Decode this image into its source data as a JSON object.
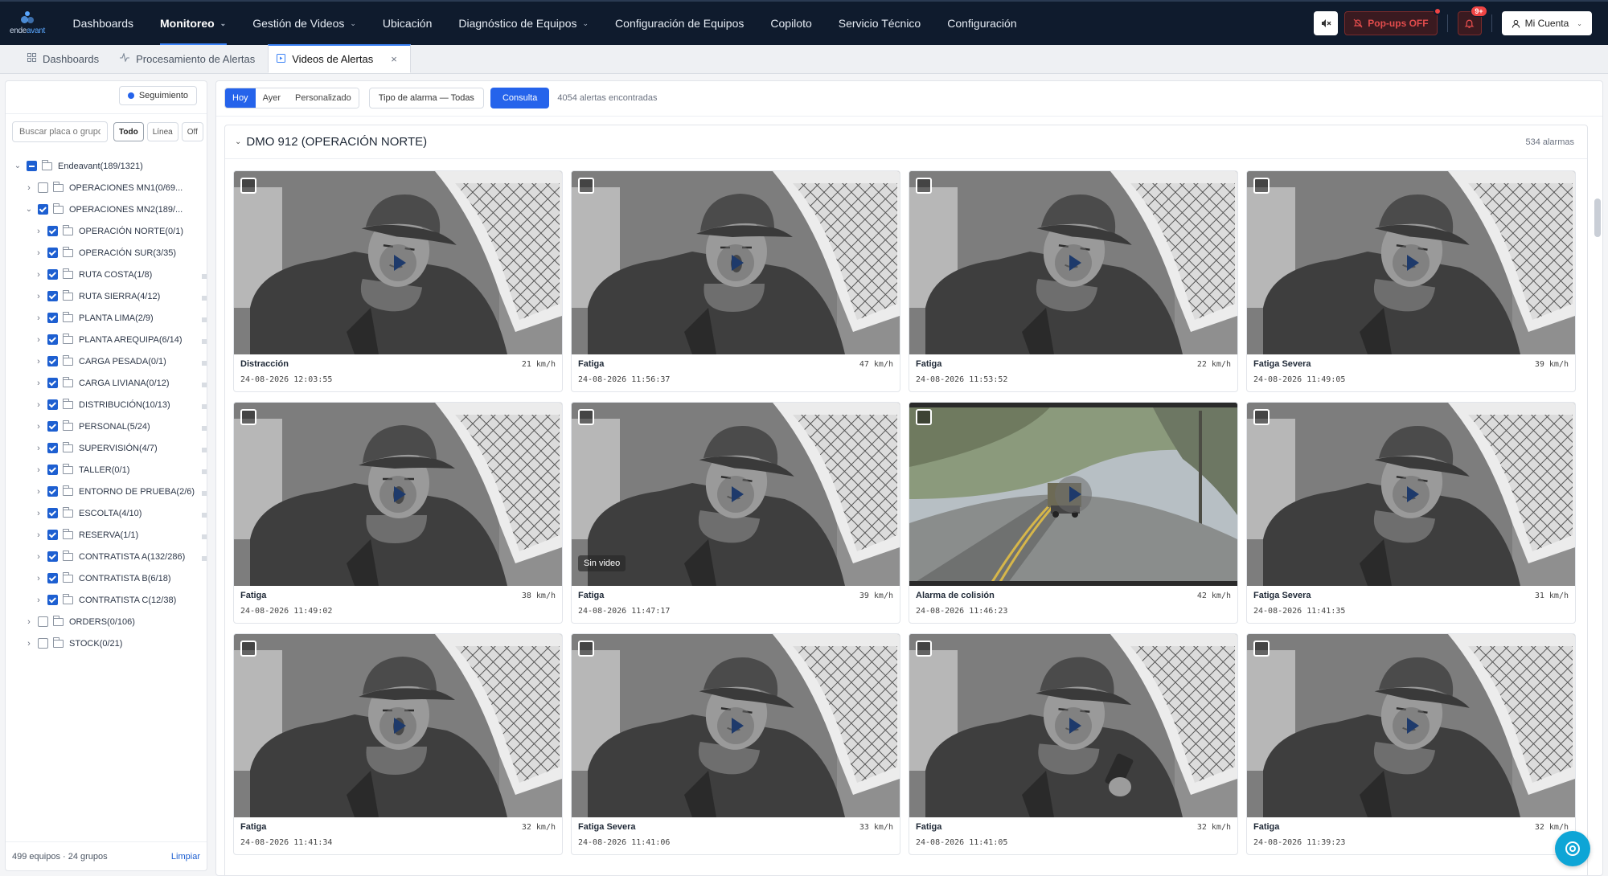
{
  "brand": {
    "logo_text_a": "ende",
    "logo_text_b": "avant"
  },
  "nav": {
    "items": [
      {
        "label": "Dashboards",
        "active": false,
        "dropdown": false
      },
      {
        "label": "Monitoreo",
        "active": true,
        "dropdown": true
      },
      {
        "label": "Gestión de Videos",
        "active": false,
        "dropdown": true
      },
      {
        "label": "Ubicación",
        "active": false,
        "dropdown": false
      },
      {
        "label": "Diagnóstico de Equipos",
        "active": false,
        "dropdown": true
      },
      {
        "label": "Configuración de Equipos",
        "active": false,
        "dropdown": false
      },
      {
        "label": "Copiloto",
        "active": false,
        "dropdown": false
      },
      {
        "label": "Servicio Técnico",
        "active": false,
        "dropdown": false
      },
      {
        "label": "Configuración",
        "active": false,
        "dropdown": false
      }
    ],
    "popups_label": "Pop-ups OFF",
    "bell_badge": "9+",
    "account_label": "Mi Cuenta"
  },
  "tabs": [
    {
      "label": "Dashboards",
      "icon": "grid-icon",
      "active": false
    },
    {
      "label": "Procesamiento de Alertas",
      "icon": "activity-icon",
      "active": false
    },
    {
      "label": "Videos de Alertas",
      "icon": "video-icon",
      "active": true
    }
  ],
  "sidebar": {
    "tracking_label": "Seguimiento",
    "search_placeholder": "Buscar placa o grupo",
    "filters": [
      "Todo",
      "Línea",
      "Off"
    ],
    "tree": [
      {
        "label": "Endeavant(189/1321)",
        "level": 0,
        "state": "partial",
        "expanded": true
      },
      {
        "label": "OPERACIONES MN1(0/69...",
        "level": 1,
        "state": "none",
        "expanded": false
      },
      {
        "label": "OPERACIONES MN2(189/...",
        "level": 1,
        "state": "checked",
        "expanded": true
      },
      {
        "label": "OPERACIÓN NORTE(0/1)",
        "level": 2,
        "state": "checked",
        "expanded": false
      },
      {
        "label": "OPERACIÓN SUR(3/35)",
        "level": 2,
        "state": "checked",
        "expanded": false
      },
      {
        "label": "RUTA COSTA(1/8)",
        "level": 2,
        "state": "checked",
        "expanded": false
      },
      {
        "label": "RUTA SIERRA(4/12)",
        "level": 2,
        "state": "checked",
        "expanded": false
      },
      {
        "label": "PLANTA LIMA(2/9)",
        "level": 2,
        "state": "checked",
        "expanded": false
      },
      {
        "label": "PLANTA AREQUIPA(6/14)",
        "level": 2,
        "state": "checked",
        "expanded": false
      },
      {
        "label": "CARGA PESADA(0/1)",
        "level": 2,
        "state": "checked",
        "expanded": false
      },
      {
        "label": "CARGA LIVIANA(0/12)",
        "level": 2,
        "state": "checked",
        "expanded": false
      },
      {
        "label": "DISTRIBUCIÓN(10/13)",
        "level": 2,
        "state": "checked",
        "expanded": false
      },
      {
        "label": "PERSONAL(5/24)",
        "level": 2,
        "state": "checked",
        "expanded": false
      },
      {
        "label": "SUPERVISIÓN(4/7)",
        "level": 2,
        "state": "checked",
        "expanded": false
      },
      {
        "label": "TALLER(0/1)",
        "level": 2,
        "state": "checked",
        "expanded": false
      },
      {
        "label": "ENTORNO DE PRUEBA(2/6)",
        "level": 2,
        "state": "checked",
        "expanded": false
      },
      {
        "label": "ESCOLTA(4/10)",
        "level": 2,
        "state": "checked",
        "expanded": false
      },
      {
        "label": "RESERVA(1/1)",
        "level": 2,
        "state": "checked",
        "expanded": false
      },
      {
        "label": "CONTRATISTA A(132/286)",
        "level": 2,
        "state": "checked",
        "expanded": false
      },
      {
        "label": "CONTRATISTA B(6/18)",
        "level": 2,
        "state": "checked",
        "expanded": false
      },
      {
        "label": "CONTRATISTA C(12/38)",
        "level": 2,
        "state": "checked",
        "expanded": false
      },
      {
        "label": "ORDERS(0/106)",
        "level": 1,
        "state": "none",
        "expanded": false
      },
      {
        "label": "STOCK(0/21)",
        "level": 1,
        "state": "none",
        "expanded": false
      }
    ],
    "footer_summary": "499 equipos · 24 grupos",
    "clear_label": "Limpiar"
  },
  "toolbar": {
    "ranges": [
      {
        "label": "Hoy",
        "active": true
      },
      {
        "label": "Ayer",
        "active": false
      },
      {
        "label": "Personalizado",
        "active": false
      }
    ],
    "alarm_type_label": "Tipo de alarma — Todas",
    "query_label": "Consulta",
    "result_count": "4054 alertas encontradas"
  },
  "group": {
    "title": "DMO 912 (OPERACIÓN NORTE)",
    "count_label": "534 alarmas"
  },
  "alerts": [
    {
      "type": "Distracción",
      "speed": "21 km/h",
      "time": "24-08-2026 12:03:55",
      "scene": "driver",
      "pose": "down",
      "no_video": false
    },
    {
      "type": "Fatiga",
      "speed": "47 km/h",
      "time": "24-08-2026 11:56:37",
      "scene": "driver",
      "pose": "yawn",
      "no_video": false
    },
    {
      "type": "Fatiga",
      "speed": "22 km/h",
      "time": "24-08-2026 11:53:52",
      "scene": "driver",
      "pose": "down",
      "no_video": false
    },
    {
      "type": "Fatiga Severa",
      "speed": "39 km/h",
      "time": "24-08-2026 11:49:05",
      "scene": "driver",
      "pose": "down",
      "no_video": false
    },
    {
      "type": "Fatiga",
      "speed": "38 km/h",
      "time": "24-08-2026 11:49:02",
      "scene": "driver",
      "pose": "yawn",
      "no_video": false
    },
    {
      "type": "Fatiga",
      "speed": "39 km/h",
      "time": "24-08-2026 11:47:17",
      "scene": "driver",
      "pose": "down",
      "no_video": true
    },
    {
      "type": "Alarma de colisión",
      "speed": "42 km/h",
      "time": "24-08-2026 11:46:23",
      "scene": "road",
      "pose": "",
      "no_video": false
    },
    {
      "type": "Fatiga Severa",
      "speed": "31 km/h",
      "time": "24-08-2026 11:41:35",
      "scene": "driver",
      "pose": "down",
      "no_video": false
    },
    {
      "type": "Fatiga",
      "speed": "32 km/h",
      "time": "24-08-2026 11:41:34",
      "scene": "driver",
      "pose": "yawn",
      "no_video": false
    },
    {
      "type": "Fatiga Severa",
      "speed": "33 km/h",
      "time": "24-08-2026 11:41:06",
      "scene": "driver",
      "pose": "down",
      "no_video": false
    },
    {
      "type": "Fatiga",
      "speed": "32 km/h",
      "time": "24-08-2026 11:41:05",
      "scene": "driver",
      "pose": "phone",
      "no_video": false
    },
    {
      "type": "Fatiga",
      "speed": "32 km/h",
      "time": "24-08-2026 11:39:23",
      "scene": "driver",
      "pose": "down",
      "no_video": false
    }
  ],
  "no_video_label": "Sin video",
  "colors": {
    "accent": "#2563eb",
    "nav_bg": "#0f1b2d",
    "alert_red": "#ef4444"
  }
}
